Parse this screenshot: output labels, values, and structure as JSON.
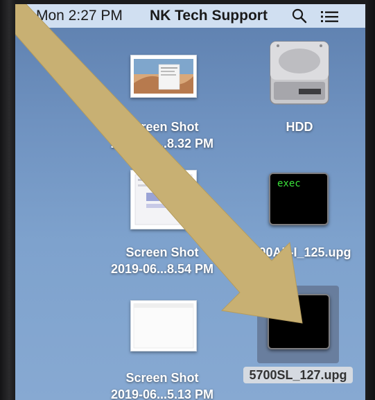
{
  "menubar": {
    "clock": "Mon 2:27 PM",
    "user": "NK Tech Support",
    "search_icon": "search-icon",
    "list_icon": "list-icon"
  },
  "desktop_items": {
    "shot1": {
      "line1": "Screen Shot",
      "line2": "2019-06...8.32 PM"
    },
    "hdd": {
      "line1": "HDD"
    },
    "shot2": {
      "line1": "Screen Shot",
      "line2": "2019-06...8.54 PM"
    },
    "upg1": {
      "line1": "5700AL-I_125.upg",
      "exec": "exec"
    },
    "shot3": {
      "line1": "Screen Shot",
      "line2": "2019-06...5.13 PM"
    },
    "upg2": {
      "line1": "5700SL_127.upg",
      "exec": "exec",
      "selected": true
    }
  },
  "colors": {
    "arrow": "#c8b073",
    "menubar": "#d6e4f4",
    "exec_text": "#3be33b"
  }
}
